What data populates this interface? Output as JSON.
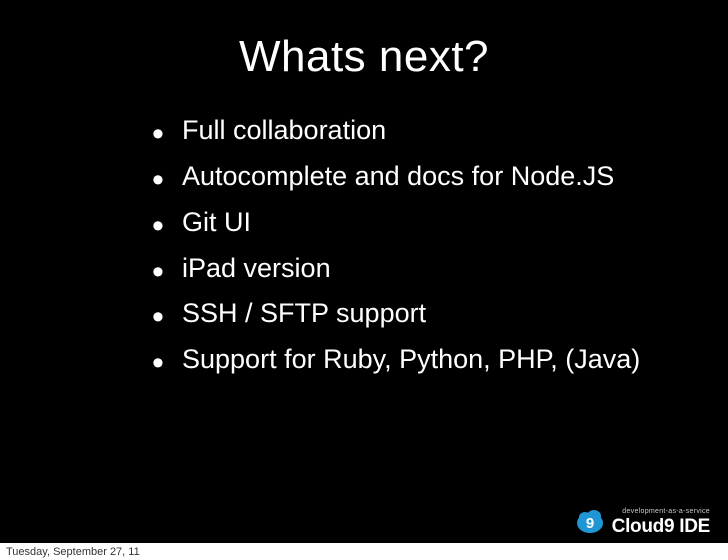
{
  "slide": {
    "title": "Whats next?",
    "bullets": [
      "Full collaboration",
      "Autocomplete and docs for Node.JS",
      "Git UI",
      "iPad version",
      "SSH / SFTP support",
      "Support for Ruby, Python, PHP, (Java)"
    ]
  },
  "footer": {
    "date": "Tuesday, September 27, 11"
  },
  "logo": {
    "tagline": "development-as-a-service",
    "name": "Cloud9 IDE",
    "badge_number": "9",
    "badge_color": "#2196d4"
  }
}
